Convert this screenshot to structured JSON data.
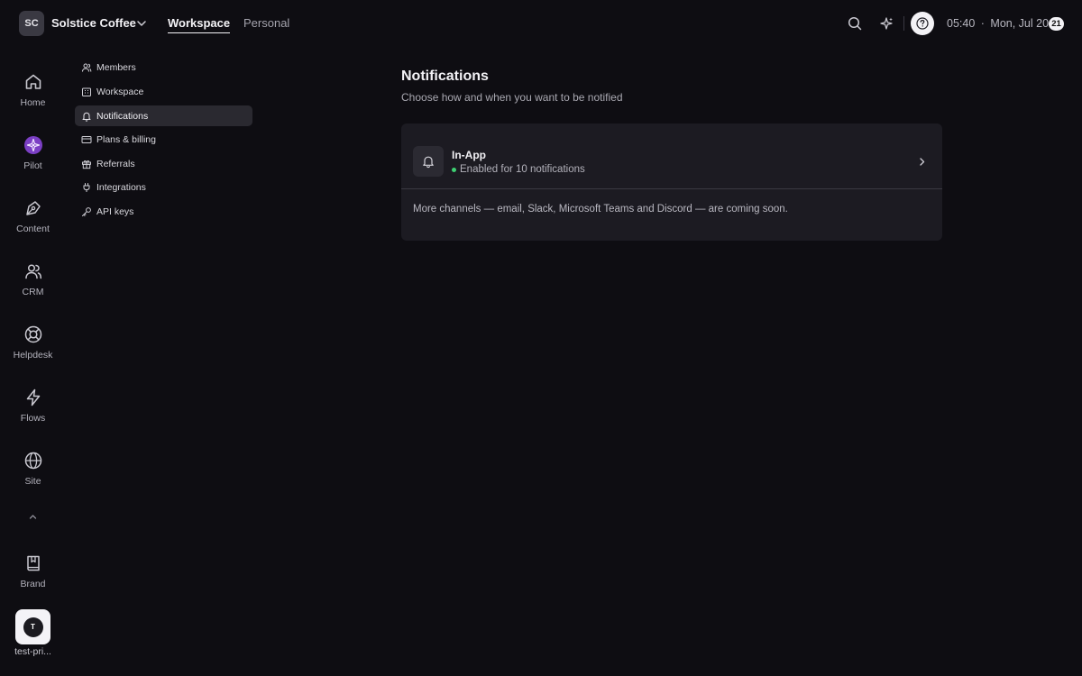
{
  "workspace": {
    "initials": "SC",
    "name": "Solstice Coffee"
  },
  "top_tabs": [
    {
      "label": "Workspace",
      "active": true
    },
    {
      "label": "Personal",
      "active": false
    }
  ],
  "header": {
    "time": "05:40",
    "separator": "·",
    "date": "Mon, Jul 20",
    "badge_count": "21"
  },
  "rail": {
    "items": [
      {
        "label": "Home",
        "icon": "home-icon"
      },
      {
        "label": "Pilot",
        "icon": "pilot-icon"
      },
      {
        "label": "Content",
        "icon": "pen-icon"
      },
      {
        "label": "CRM",
        "icon": "users-icon"
      },
      {
        "label": "Helpdesk",
        "icon": "lifebuoy-icon"
      },
      {
        "label": "Flows",
        "icon": "lightning-icon"
      },
      {
        "label": "Site",
        "icon": "globe-icon"
      }
    ],
    "brand": {
      "label": "Brand",
      "icon": "book-icon"
    },
    "user": {
      "initial": "T",
      "label": "test-pri..."
    }
  },
  "settings_nav": [
    {
      "label": "Members",
      "icon": "users-icon",
      "active": false
    },
    {
      "label": "Workspace",
      "icon": "building-icon",
      "active": false
    },
    {
      "label": "Notifications",
      "icon": "bell-icon",
      "active": true
    },
    {
      "label": "Plans & billing",
      "icon": "credit-card-icon",
      "active": false
    },
    {
      "label": "Referrals",
      "icon": "gift-icon",
      "active": false
    },
    {
      "label": "Integrations",
      "icon": "plug-icon",
      "active": false
    },
    {
      "label": "API keys",
      "icon": "key-icon",
      "active": false
    }
  ],
  "main": {
    "title": "Notifications",
    "subtitle": "Choose how and when you want to be notified",
    "channel": {
      "title": "In-App",
      "status": "Enabled for 10 notifications",
      "status_color": "#3ecf72"
    },
    "note": "More channels — email, Slack, Microsoft Teams and Discord — are coming soon."
  },
  "colors": {
    "background": "#0e0d12",
    "card": "#1c1b22",
    "active_nav": "#2a2930",
    "pilot_accent": "#7b3fc4"
  }
}
